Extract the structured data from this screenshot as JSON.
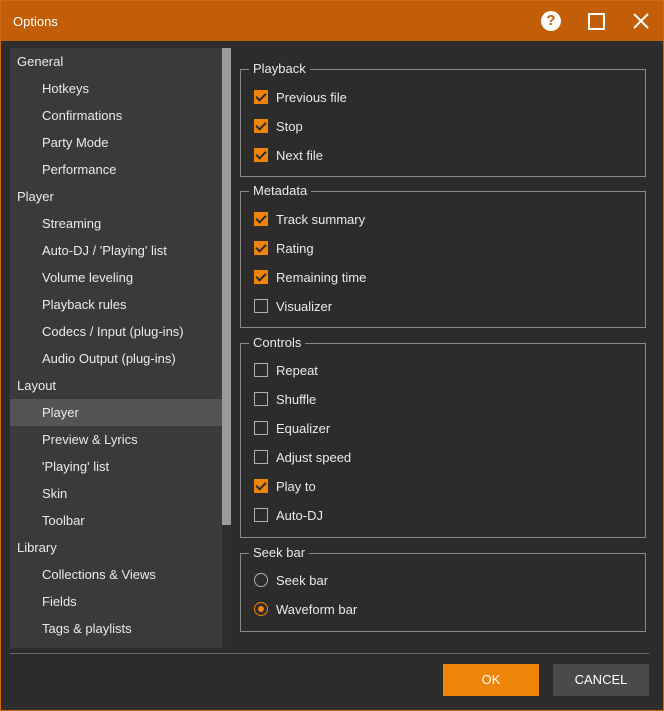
{
  "window": {
    "title": "Options"
  },
  "colors": {
    "accent": "#f0830a",
    "titlebar": "#c25e08",
    "panel": "#2c2c2c"
  },
  "icons": {
    "help": "question-circle-icon",
    "maximize": "square-icon",
    "close": "x-icon"
  },
  "sidebar": {
    "items": [
      {
        "label": "General",
        "type": "category"
      },
      {
        "label": "Hotkeys",
        "type": "sub"
      },
      {
        "label": "Confirmations",
        "type": "sub"
      },
      {
        "label": "Party Mode",
        "type": "sub"
      },
      {
        "label": "Performance",
        "type": "sub"
      },
      {
        "label": "Player",
        "type": "category"
      },
      {
        "label": "Streaming",
        "type": "sub"
      },
      {
        "label": "Auto-DJ / 'Playing' list",
        "type": "sub"
      },
      {
        "label": "Volume leveling",
        "type": "sub"
      },
      {
        "label": "Playback rules",
        "type": "sub"
      },
      {
        "label": "Codecs / Input (plug-ins)",
        "type": "sub"
      },
      {
        "label": "Audio Output (plug-ins)",
        "type": "sub"
      },
      {
        "label": "Layout",
        "type": "category"
      },
      {
        "label": "Player",
        "type": "sub",
        "selected": true
      },
      {
        "label": "Preview & Lyrics",
        "type": "sub"
      },
      {
        "label": "'Playing' list",
        "type": "sub"
      },
      {
        "label": "Skin",
        "type": "sub"
      },
      {
        "label": "Toolbar",
        "type": "sub"
      },
      {
        "label": "Library",
        "type": "category"
      },
      {
        "label": "Collections & Views",
        "type": "sub"
      },
      {
        "label": "Fields",
        "type": "sub"
      },
      {
        "label": "Tags & playlists",
        "type": "sub"
      }
    ]
  },
  "groups": {
    "playback": {
      "title": "Playback",
      "options": [
        {
          "label": "Previous file",
          "checked": true
        },
        {
          "label": "Stop",
          "checked": true
        },
        {
          "label": "Next file",
          "checked": true
        }
      ]
    },
    "metadata": {
      "title": "Metadata",
      "options": [
        {
          "label": "Track summary",
          "checked": true
        },
        {
          "label": "Rating",
          "checked": true
        },
        {
          "label": "Remaining time",
          "checked": true
        },
        {
          "label": "Visualizer",
          "checked": false
        }
      ]
    },
    "controls": {
      "title": "Controls",
      "options": [
        {
          "label": "Repeat",
          "checked": false
        },
        {
          "label": "Shuffle",
          "checked": false
        },
        {
          "label": "Equalizer",
          "checked": false
        },
        {
          "label": "Adjust speed",
          "checked": false
        },
        {
          "label": "Play to",
          "checked": true
        },
        {
          "label": "Auto-DJ",
          "checked": false
        }
      ]
    },
    "seekbar": {
      "title": "Seek bar",
      "options": [
        {
          "label": "Seek bar",
          "selected": false
        },
        {
          "label": "Waveform bar",
          "selected": true
        }
      ]
    }
  },
  "footer": {
    "ok_label": "OK",
    "cancel_label": "CANCEL"
  }
}
